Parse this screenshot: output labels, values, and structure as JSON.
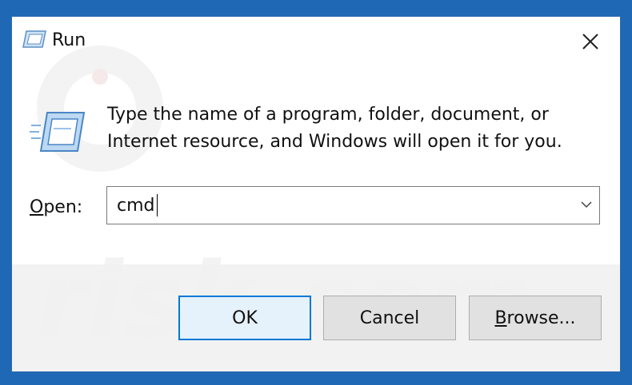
{
  "window": {
    "title": "Run",
    "icon": "run-icon",
    "close_icon": "close-icon"
  },
  "description": {
    "line1": "Type the name of a program, folder, document, or",
    "line2": "Internet resource, and Windows will open it for you."
  },
  "open_field": {
    "label_mnemonic": "O",
    "label_rest": "pen:",
    "value": "cmd",
    "dropdown_icon": "chevron-down-icon"
  },
  "buttons": {
    "ok": "OK",
    "cancel": "Cancel",
    "browse_mnemonic": "B",
    "browse_rest": "rowse..."
  },
  "watermark_text": "risk.com",
  "colors": {
    "desktop": "#1f68b6",
    "accent": "#0078d7",
    "footer": "#f0f0f0"
  }
}
